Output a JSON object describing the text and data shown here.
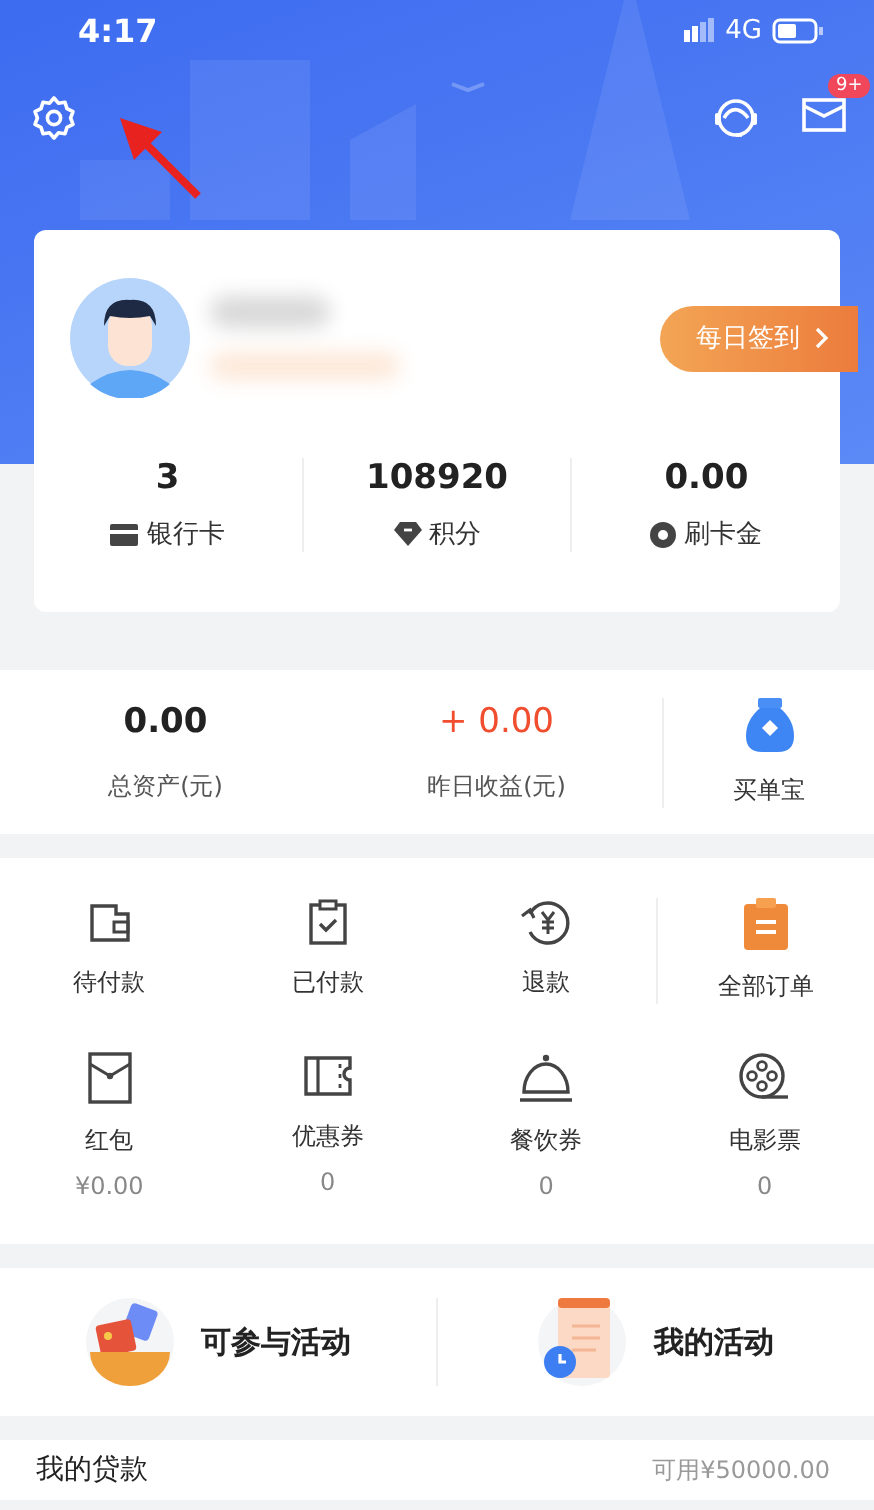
{
  "status_bar": {
    "time": "4:17",
    "network": "4G"
  },
  "header": {
    "message_badge": "9+"
  },
  "profile": {
    "checkin_button": "每日签到",
    "stats": [
      {
        "value": "3",
        "label": "银行卡"
      },
      {
        "value": "108920",
        "label": "积分"
      },
      {
        "value": "0.00",
        "label": "刷卡金"
      }
    ]
  },
  "assets": {
    "items": [
      {
        "value": "0.00",
        "label": "总资产(元)",
        "kind": "plain"
      },
      {
        "value": "+ 0.00",
        "label": "昨日收益(元)",
        "kind": "positive"
      }
    ],
    "entry": {
      "label": "买单宝"
    }
  },
  "orders": {
    "items": [
      {
        "label": "待付款"
      },
      {
        "label": "已付款"
      },
      {
        "label": "退款"
      }
    ],
    "all": {
      "label": "全部订单"
    }
  },
  "benefits": [
    {
      "label": "红包",
      "value": "¥0.00"
    },
    {
      "label": "优惠券",
      "value": "0"
    },
    {
      "label": "餐饮券",
      "value": "0"
    },
    {
      "label": "电影票",
      "value": "0"
    }
  ],
  "activities": [
    {
      "label": "可参与活动"
    },
    {
      "label": "我的活动"
    }
  ],
  "loan": {
    "title": "我的贷款",
    "available": "可用¥50000.00"
  }
}
